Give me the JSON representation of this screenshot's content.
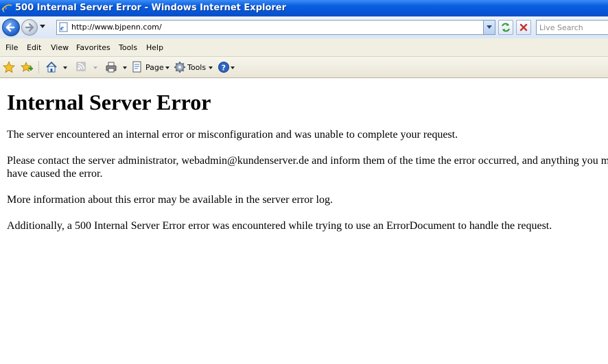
{
  "window": {
    "title": "500 Internal Server Error - Windows Internet Explorer"
  },
  "navbar": {
    "url": "http://www.bjpenn.com/",
    "search_placeholder": "Live Search"
  },
  "menu": [
    "File",
    "Edit",
    "View",
    "Favorites",
    "Tools",
    "Help"
  ],
  "command_bar": {
    "page_label": "Page",
    "tools_label": "Tools"
  },
  "page": {
    "heading": "Internal Server Error",
    "p1": "The server encountered an internal error or misconfiguration and was unable to complete your request.",
    "p2_line1": "Please contact the server administrator, webadmin@kundenserver.de and inform them of the time the error occurred, and anything you might have done that may",
    "p2_line2": "have caused the error.",
    "p3": "More information about this error may be available in the server error log.",
    "p4": "Additionally, a 500 Internal Server Error error was encountered while trying to use an ErrorDocument to handle the request."
  },
  "colors": {
    "titlebar": "#0a5fe0",
    "menubar": "#f1efe2"
  }
}
